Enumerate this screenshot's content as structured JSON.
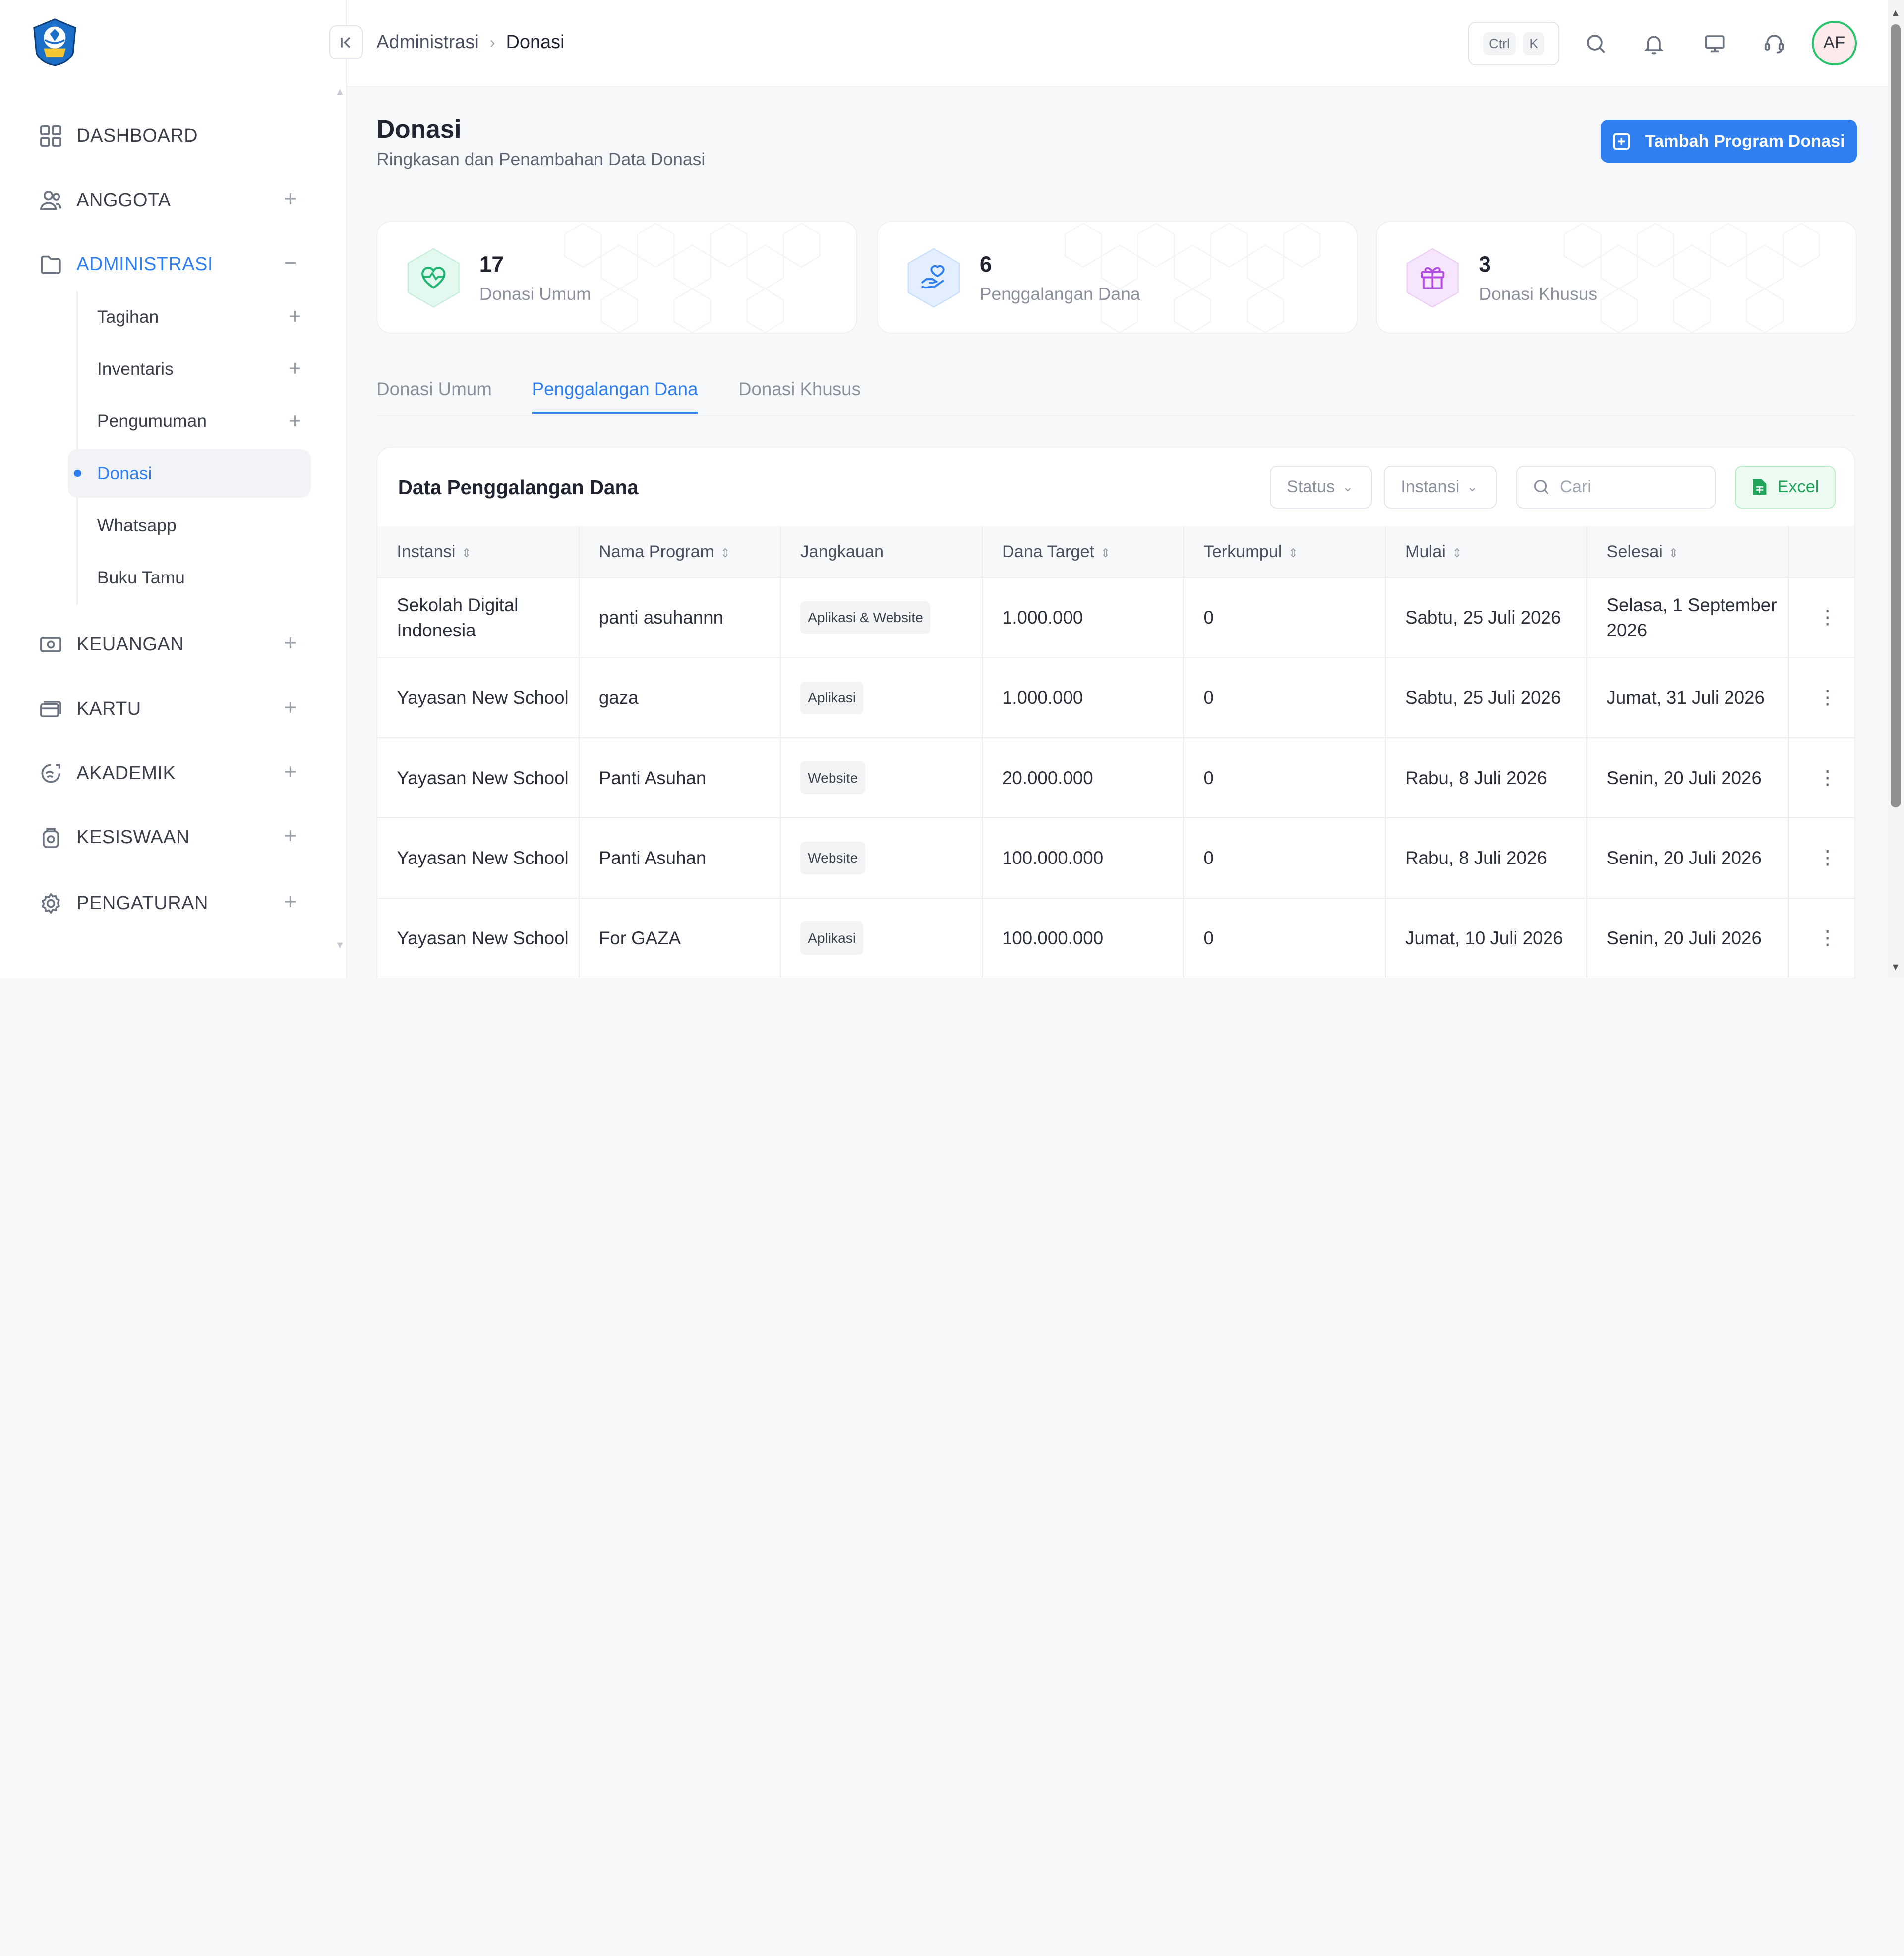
{
  "sidebar": {
    "menu": [
      {
        "label": "DASHBOARD",
        "icon": "dashboard-grid-icon"
      },
      {
        "label": "ANGGOTA",
        "icon": "users-icon"
      },
      {
        "label": "ADMINISTRASI",
        "icon": "folder-icon"
      },
      {
        "label": "KEUANGAN",
        "icon": "money-icon"
      },
      {
        "label": "KARTU",
        "icon": "card-icon"
      },
      {
        "label": "AKADEMIK",
        "icon": "academic-icon"
      },
      {
        "label": "KESISWAAN",
        "icon": "student-icon"
      },
      {
        "label": "PENGATURAN",
        "icon": "gear-icon"
      }
    ],
    "submenu": [
      {
        "label": "Tagihan"
      },
      {
        "label": "Inventaris"
      },
      {
        "label": "Pengumuman"
      },
      {
        "label": "Donasi"
      },
      {
        "label": "Whatsapp"
      },
      {
        "label": "Buku Tamu"
      }
    ]
  },
  "topbar": {
    "breadcrumb": [
      "Administrasi",
      "Donasi"
    ],
    "shortcut": [
      "Ctrl",
      "K"
    ],
    "avatar": "AF"
  },
  "page": {
    "title": "Donasi",
    "subtitle": "Ringkasan dan Penambahan Data Donasi",
    "add_button": "Tambah Program Donasi"
  },
  "stats": [
    {
      "value": "17",
      "label": "Donasi Umum",
      "color": "#22b573"
    },
    {
      "value": "6",
      "label": "Penggalangan Dana",
      "color": "#2f7ff0"
    },
    {
      "value": "3",
      "label": "Donasi Khusus",
      "color": "#b04be0"
    }
  ],
  "tabs": [
    "Donasi Umum",
    "Penggalangan Dana",
    "Donasi Khusus"
  ],
  "table_card": {
    "title": "Data Penggalangan Dana",
    "filter_status": "Status",
    "filter_instansi": "Instansi",
    "search_placeholder": "Cari",
    "excel": "Excel",
    "columns": [
      "Instansi",
      "Nama Program",
      "Jangkauan",
      "Dana Target",
      "Terkumpul",
      "Mulai",
      "Selesai"
    ],
    "rows": [
      {
        "instansi": "Sekolah Digital Indonesia",
        "program": "panti asuhannn",
        "jangkauan": "Aplikasi & Website",
        "target": "1.000.000",
        "terkumpul": "0",
        "mulai": "Sabtu, 25 Juli 2026",
        "selesai": "Selasa, 1 September 2026"
      },
      {
        "instansi": "Yayasan New School",
        "program": "gaza",
        "jangkauan": "Aplikasi",
        "target": "1.000.000",
        "terkumpul": "0",
        "mulai": "Sabtu, 25 Juli 2026",
        "selesai": "Jumat, 31 Juli 2026"
      },
      {
        "instansi": "Yayasan New School",
        "program": "Panti Asuhan",
        "jangkauan": "Website",
        "target": "20.000.000",
        "terkumpul": "0",
        "mulai": "Rabu, 8 Juli 2026",
        "selesai": "Senin, 20 Juli 2026"
      },
      {
        "instansi": "Yayasan New School",
        "program": "Panti Asuhan",
        "jangkauan": "Website",
        "target": "100.000.000",
        "terkumpul": "0",
        "mulai": "Rabu, 8 Juli 2026",
        "selesai": "Senin, 20 Juli 2026"
      },
      {
        "instansi": "Yayasan New School",
        "program": "For GAZA",
        "jangkauan": "Aplikasi",
        "target": "100.000.000",
        "terkumpul": "0",
        "mulai": "Jumat, 10 Juli 2026",
        "selesai": "Senin, 20 Juli 2026"
      }
    ]
  }
}
